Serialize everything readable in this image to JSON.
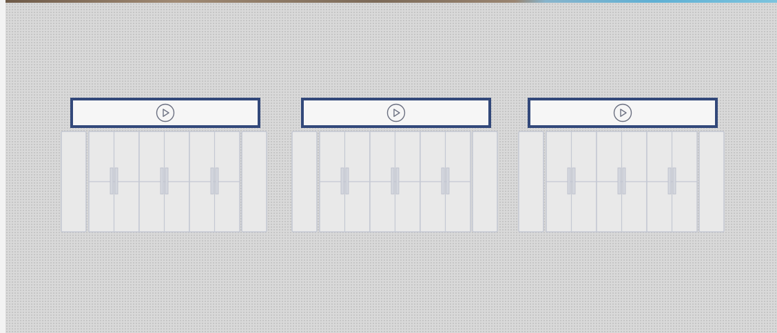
{
  "canvas": {
    "background": "#d9d9d9",
    "dot_color": "#b3b3b3"
  },
  "top_strip": {
    "colors": [
      "#6e5a48",
      "#a08a74",
      "#7c6a58",
      "#5fb0d4",
      "#7cc4de"
    ]
  },
  "cabinet_groups": [
    {
      "id": "group-1",
      "play_icon": "play-circle-icon",
      "accent": "#32487a"
    },
    {
      "id": "group-2",
      "play_icon": "play-circle-icon",
      "accent": "#32487a"
    },
    {
      "id": "group-3",
      "play_icon": "play-circle-icon",
      "accent": "#32487a"
    }
  ]
}
